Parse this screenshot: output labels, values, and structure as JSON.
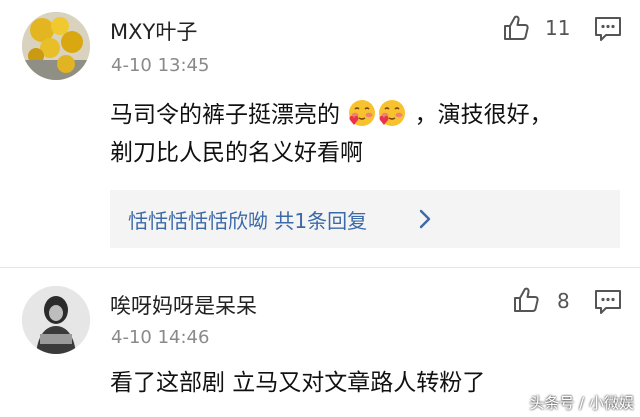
{
  "comments": [
    {
      "username": "MXY叶子",
      "timestamp": "4-10 13:45",
      "likes": "11",
      "content_line1_a": "马司令的裤子挺漂亮的",
      "content_line1_b": "，演技很好，",
      "content_line2": "剃刀比人民的名义好看啊",
      "emoji_count": 2,
      "replies_label": "恬恬恬恬恬欣呦 共1条回复"
    },
    {
      "username": "唉呀妈呀是呆呆",
      "timestamp": "4-10 14:46",
      "likes": "8",
      "content_line1": "看了这部剧 立马又对文章路人转粉了"
    }
  ],
  "watermark": "头条号 / 小微娱",
  "colors": {
    "link": "#3c6aa8",
    "timestamp": "#8a8a8a",
    "reply_box_bg": "#f4f4f4"
  },
  "icons": [
    "thumbs-up-icon",
    "comment-reply-icon",
    "chevron-right-icon",
    "blushing-emoji-icon"
  ]
}
